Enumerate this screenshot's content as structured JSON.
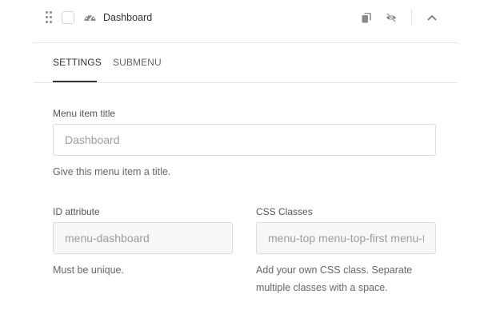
{
  "menu_item": {
    "title": "Dashboard",
    "icon": "dashboard-gauge-icon"
  },
  "actions": {
    "copy_icon": "copy-icon",
    "hide_icon": "eye-slash-icon",
    "collapse_icon": "chevron-up-icon"
  },
  "tabs": [
    {
      "label": "SETTINGS",
      "active": true
    },
    {
      "label": "SUBMENU",
      "active": false
    }
  ],
  "fields": {
    "title": {
      "label": "Menu item title",
      "value": "",
      "placeholder": "Dashboard",
      "help": "Give this menu item a title."
    },
    "id_attribute": {
      "label": "ID attribute",
      "value": "menu-dashboard",
      "help": "Must be unique."
    },
    "css_classes": {
      "label": "CSS Classes",
      "value": "menu-top menu-top-first menu-top-last",
      "help": "Add your own CSS class. Separate multiple classes with a space."
    }
  },
  "colors": {
    "text": "#333333",
    "muted": "#666666",
    "border": "#dcdcdc",
    "readonly_bg": "#f7f7f7"
  }
}
